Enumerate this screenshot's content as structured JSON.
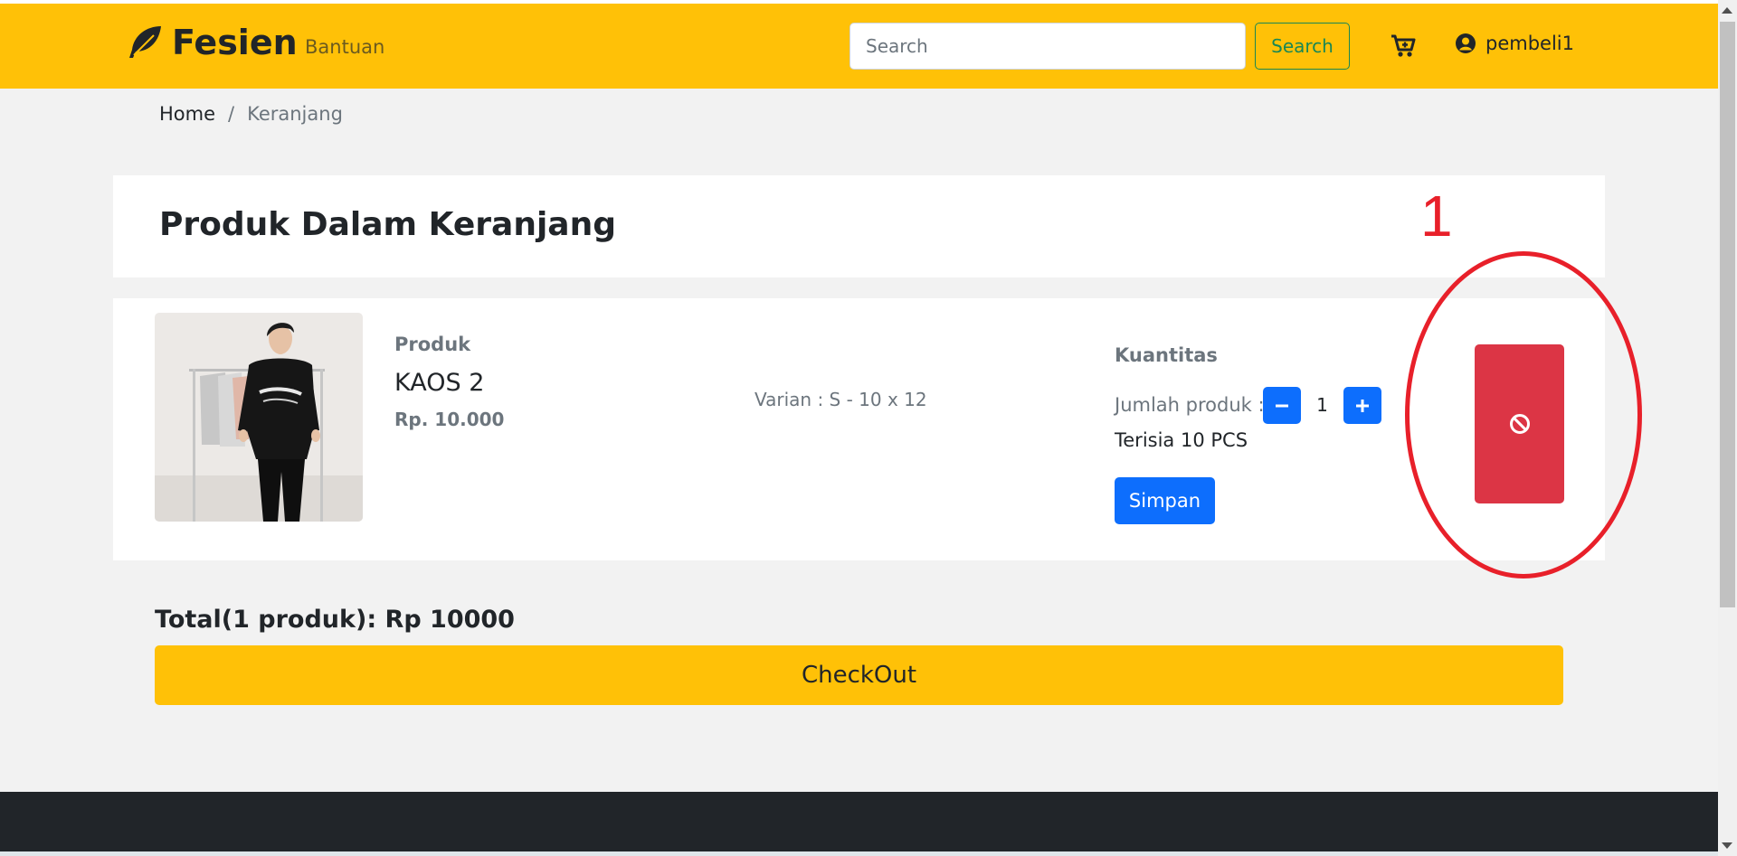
{
  "navbar": {
    "brand": "Fesien",
    "help_link": "Bantuan",
    "search_placeholder": "Search",
    "search_value": "",
    "search_button": "Search",
    "user_name": "pembeli1",
    "colors": {
      "background": "#ffc107",
      "search_button": "#198754"
    }
  },
  "breadcrumb": {
    "home": "Home",
    "separator": "/",
    "current": "Keranjang"
  },
  "cart": {
    "title": "Produk Dalam Keranjang",
    "item": {
      "label": "Produk",
      "name": "KAOS 2",
      "price": "Rp. 10.000",
      "variant": "Varian : S - 10 x 12",
      "quantity_label": "Kuantitas",
      "jumlah_label": "Jumlah produk :",
      "quantity": "1",
      "stock": "Terisia 10 PCS",
      "save_button": "Simpan",
      "delete_icon": "ban-icon"
    },
    "total": "Total(1 produk): Rp 10000",
    "checkout_button": "CheckOut"
  },
  "annotation": {
    "number": "1",
    "color": "#e8202a"
  },
  "colors": {
    "primary": "#0d6efd",
    "danger": "#dc3545",
    "footer": "#212529"
  }
}
